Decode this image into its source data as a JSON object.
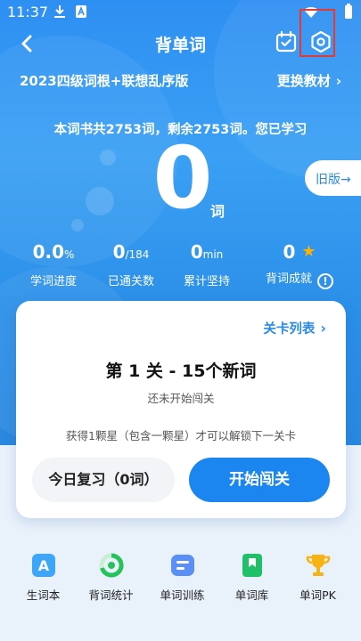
{
  "status": {
    "time": "11:37"
  },
  "header": {
    "title": "背单词",
    "back_icon": "back-arrow-icon",
    "calendar_icon": "calendar-check-icon",
    "settings_icon": "gear-icon"
  },
  "book": {
    "name": "2023四级词根+联想乱序版",
    "change_label": "更换教材"
  },
  "summary": "本词书共2753词，剩余2753词。您已学习",
  "learned": {
    "value": "0",
    "unit": "词"
  },
  "old_version": "旧版→",
  "stats": [
    {
      "value": "0.0",
      "suffix": "%",
      "label": "学词进度"
    },
    {
      "value": "0",
      "suffix": "/184",
      "label": "已通关数"
    },
    {
      "value": "0",
      "suffix": "min",
      "label": "累计坚持"
    },
    {
      "value": "0",
      "suffix": "",
      "label": "背词成就"
    }
  ],
  "card": {
    "levels_link": "关卡列表",
    "level_title": "第 1 关 - 15个新词",
    "level_status": "还未开始闯关",
    "unlock_note": "获得1颗星（包含一颗星）才可以解锁下一关卡",
    "review_button": "今日复习（0词）",
    "start_button": "开始闯关"
  },
  "nav": [
    {
      "label": "生词本",
      "icon": "vocab-book-icon"
    },
    {
      "label": "背词统计",
      "icon": "stats-ring-icon"
    },
    {
      "label": "单词训练",
      "icon": "training-icon"
    },
    {
      "label": "单词库",
      "icon": "word-bank-icon"
    },
    {
      "label": "单词PK",
      "icon": "trophy-icon"
    }
  ],
  "colors": {
    "primary": "#1b86f0",
    "hero": "#2e8ff2",
    "star": "#ffb300",
    "highlight": "#e53935"
  }
}
